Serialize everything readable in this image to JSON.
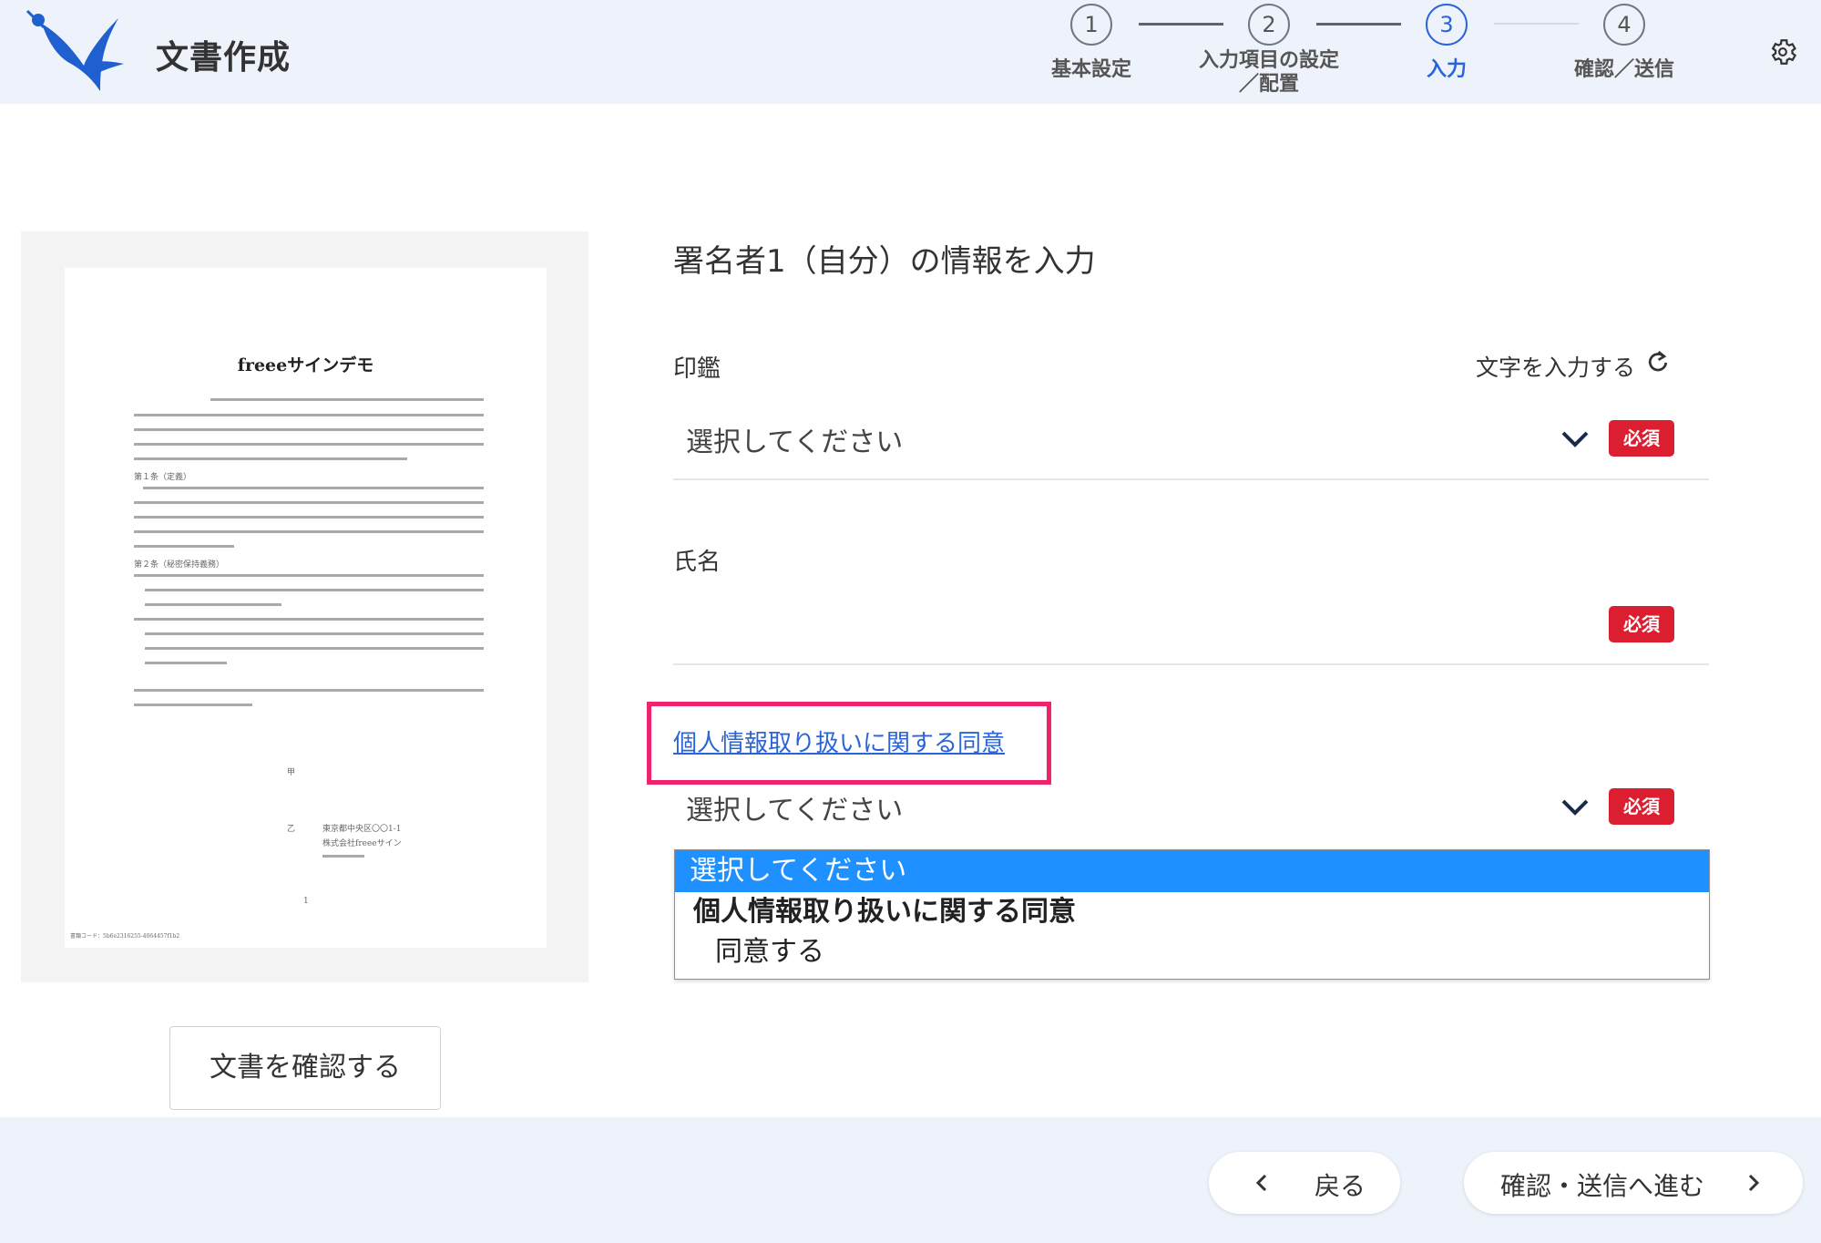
{
  "header": {
    "title": "文書作成",
    "steps": [
      {
        "number": "1",
        "label": "基本設定",
        "state": "done"
      },
      {
        "number": "2",
        "label_line1": "入力項目の設定",
        "label_line2": "／配置",
        "state": "done"
      },
      {
        "number": "3",
        "label": "入力",
        "state": "active"
      },
      {
        "number": "4",
        "label": "確認／送信",
        "state": "upcoming"
      }
    ],
    "settings_icon": "gear-icon"
  },
  "preview": {
    "doc_title": "freeeサインデモ",
    "page_number": "1",
    "party_a": "甲",
    "party_b": "乙",
    "section1": "第１条（定義）",
    "section2": "第２条（秘密保持義務）",
    "address": "東京都中央区〇〇1-1",
    "company": "株式会社freeeサイン",
    "footer_code": "書類コード：5b6e2316255-4064457f1b2"
  },
  "confirm_document_button": "文書を確認する",
  "form": {
    "title": "署名者1（自分）の情報を入力",
    "seal": {
      "label": "印鑑",
      "text_input_link": "文字を入力する",
      "placeholder": "選択してください",
      "required": "必須"
    },
    "name": {
      "label": "氏名",
      "value": "",
      "required": "必須"
    },
    "consent": {
      "link": "個人情報取り扱いに関する同意",
      "placeholder": "選択してください",
      "required": "必須",
      "options": {
        "selected": "選択してください",
        "group": "個人情報取り扱いに関する同意",
        "item": "同意する"
      }
    }
  },
  "footer": {
    "back_label": "戻る",
    "next_label": "確認・送信へ進む"
  },
  "colors": {
    "accent": "#2a64d8",
    "required": "#dc1f30",
    "highlight": "#f0246e",
    "header_bg": "#eef3fb",
    "selected_option": "#1e90ff"
  }
}
